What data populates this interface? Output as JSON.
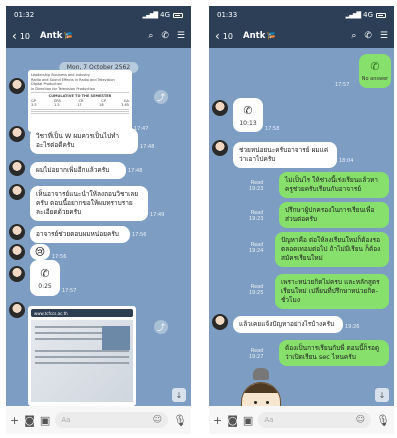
{
  "left": {
    "status": {
      "time": "01:32",
      "network": "4G"
    },
    "header": {
      "count": "10",
      "name": "Antk"
    },
    "date": "Mon, 7 October 2562",
    "doc_card": {
      "lines": [
        "Leadership Business and Industry",
        "Radio and Sound Effects in Radio and Television",
        "Digital Production",
        "In Direction for Television Production"
      ],
      "heading": "CUMULATIVE TO THE SEMESTER",
      "cols": [
        "GP",
        "GPA",
        "CR",
        "CP",
        "GA"
      ],
      "vals": [
        "3.5",
        "1.5",
        "17",
        "18",
        "3.65"
      ],
      "time": "17:47"
    },
    "messages": [
      {
        "text": "วิชาที่เป็น W ผมควรเป็นไปทำอะไรต่อดีครับ",
        "time": "17:48"
      },
      {
        "text": "ผมไม่อยากเพิ่มอีกแล้วครับ",
        "time": "17:48"
      },
      {
        "text": "เห็นอาจารย์แนะนำให้ลงถอนวิชาเลยครับ ตอนนี้อยากขอให้ผมทราบรายละเอียดด้วยครับ",
        "time": "17:49"
      },
      {
        "text": "อาจารย์ช่วยตอบผมหน่อยครับ",
        "time": "17:56"
      }
    ],
    "sticker": "😢",
    "sticker_time": "17:56",
    "call_time": "0:25",
    "call_stamp": "17:57",
    "photo": {
      "url": "www.tcfccs.ac.th"
    },
    "input_placeholder": "Aa"
  },
  "right": {
    "status": {
      "time": "01:33",
      "network": "4G"
    },
    "header": {
      "count": "10",
      "name": "Antk"
    },
    "no_answer": "No answer",
    "no_answer_time": "17:57",
    "call_time": "10:13",
    "call_stamp": "17:58",
    "messages": [
      {
        "text": "ช่วยหน่อยนะครับอาจารย์ ผมแค่ว่าเอาไปครับ",
        "time": "18:04",
        "me": false
      },
      {
        "text": "ไม่เป็นไร ให้ช่วงนี้เร่งเรียนแล้วหาครูช่วยครับเรียนกับอาจารย์",
        "time": "19:23",
        "me": true,
        "read": "Read"
      },
      {
        "text": "ปรึกษาผู้ปกครองในการเรียนเพื่อส่วนต่อครับ",
        "time": "19:23",
        "me": true,
        "read": "Read"
      },
      {
        "text": "ปัญหาคือ ต่อให้ลงเรียนใหม่ก็ต้องรอตลอดเทอมต่อไป ถ้าไม่มีเรียน ก็ต้องสมัครเรียนใหม่",
        "time": "19:24",
        "me": true,
        "read": "Read"
      },
      {
        "text": "เพราะหน่วยกิตไม่ครบ และหลักสูตรเรียนใหม่ เปลี่ยนที่ปรึกษาหน่วยกิต-ชั่วโมง",
        "time": "19:25",
        "me": true,
        "read": "Read"
      },
      {
        "text": "แล้วเคยแจ้งปัญหาอย่างไรบ้างครับ",
        "time": "19:26",
        "me": false
      },
      {
        "text": "ต้องเป็นการเรียนกับพี่ ตอนนี้ก็รอดูว่าเปิดเรียน sec ไหนครับ",
        "time": "19:27",
        "me": true,
        "read": "Read"
      }
    ],
    "input_placeholder": "Aa"
  },
  "colors": {
    "header": "#2c3f57",
    "chat_bg": "#7d9ec2",
    "my_bubble": "#86e06b",
    "their_bubble": "#ffffff"
  }
}
